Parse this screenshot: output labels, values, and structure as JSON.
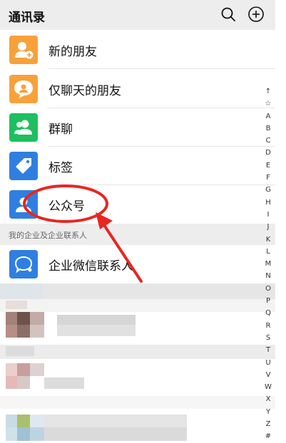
{
  "header": {
    "title": "通讯录"
  },
  "rows": [
    {
      "label": "新的朋友",
      "color": "#f8a13a"
    },
    {
      "label": "仅聊天的朋友",
      "color": "#f8a13a"
    },
    {
      "label": "群聊",
      "color": "#1dbf5e"
    },
    {
      "label": "标签",
      "color": "#2f7fe0"
    },
    {
      "label": "公众号",
      "color": "#2f7fe0"
    }
  ],
  "section": {
    "title": "我的企业及企业联系人"
  },
  "enterprise_row": {
    "label": "企业微信联系人",
    "color": "#2f7fe0"
  },
  "alpha_index": [
    "↑",
    "☆",
    "A",
    "B",
    "C",
    "D",
    "E",
    "F",
    "G",
    "H",
    "I",
    "J",
    "K",
    "L",
    "M",
    "N",
    "O",
    "P",
    "Q",
    "R",
    "S",
    "T",
    "U",
    "V",
    "W",
    "X",
    "Y",
    "Z",
    "#"
  ],
  "annotation": {
    "color": "#e8261f"
  }
}
